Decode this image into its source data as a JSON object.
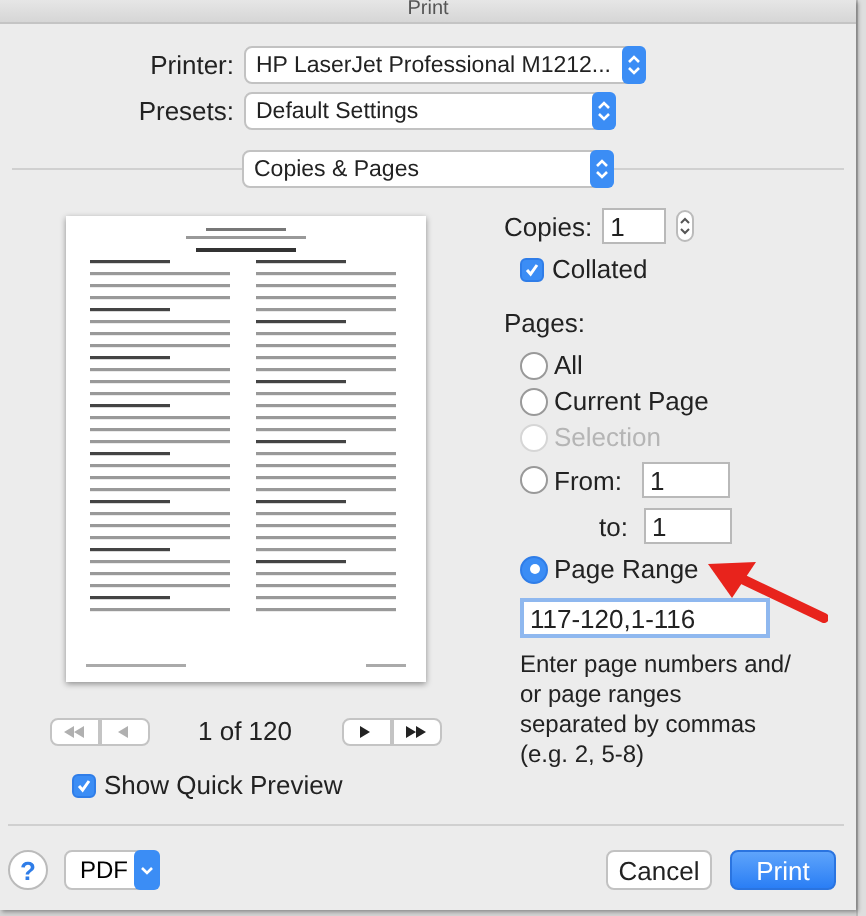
{
  "window": {
    "title": "Print"
  },
  "printer": {
    "label": "Printer:",
    "value": "HP LaserJet Professional M1212..."
  },
  "presets": {
    "label": "Presets:",
    "value": "Default Settings"
  },
  "section": {
    "value": "Copies & Pages"
  },
  "preview": {
    "page_indicator": "1 of 120",
    "nav_buttons": [
      {
        "kind": "first",
        "disabled": true
      },
      {
        "kind": "prev",
        "disabled": true
      },
      {
        "kind": "next",
        "disabled": false
      },
      {
        "kind": "last",
        "disabled": false
      }
    ]
  },
  "copies": {
    "label": "Copies:",
    "value": "1"
  },
  "collated": {
    "label": "Collated",
    "checked": true
  },
  "pages": {
    "label": "Pages:",
    "options": [
      {
        "kind": "plain",
        "label": "All",
        "selected": false,
        "disabled": false
      },
      {
        "kind": "plain",
        "label": "Current Page",
        "selected": false,
        "disabled": false
      },
      {
        "kind": "plain",
        "label": "Selection",
        "selected": false,
        "disabled": true
      },
      {
        "kind": "from",
        "label": "From:",
        "selected": false,
        "disabled": false,
        "from_value": "1",
        "to_label": "to:",
        "to_value": "1"
      },
      {
        "kind": "range",
        "label": "Page Range",
        "selected": true,
        "disabled": false,
        "value": "117-120,1-116",
        "hint": "Enter page numbers and/ or page ranges separated by commas (e.g. 2, 5-8)"
      }
    ]
  },
  "show_quick_preview": {
    "label": "Show Quick Preview",
    "checked": true
  },
  "footer": {
    "help": "?",
    "pdf": "PDF",
    "cancel": "Cancel",
    "print": "Print"
  },
  "annotations": [
    {
      "kind": "arrow"
    }
  ]
}
